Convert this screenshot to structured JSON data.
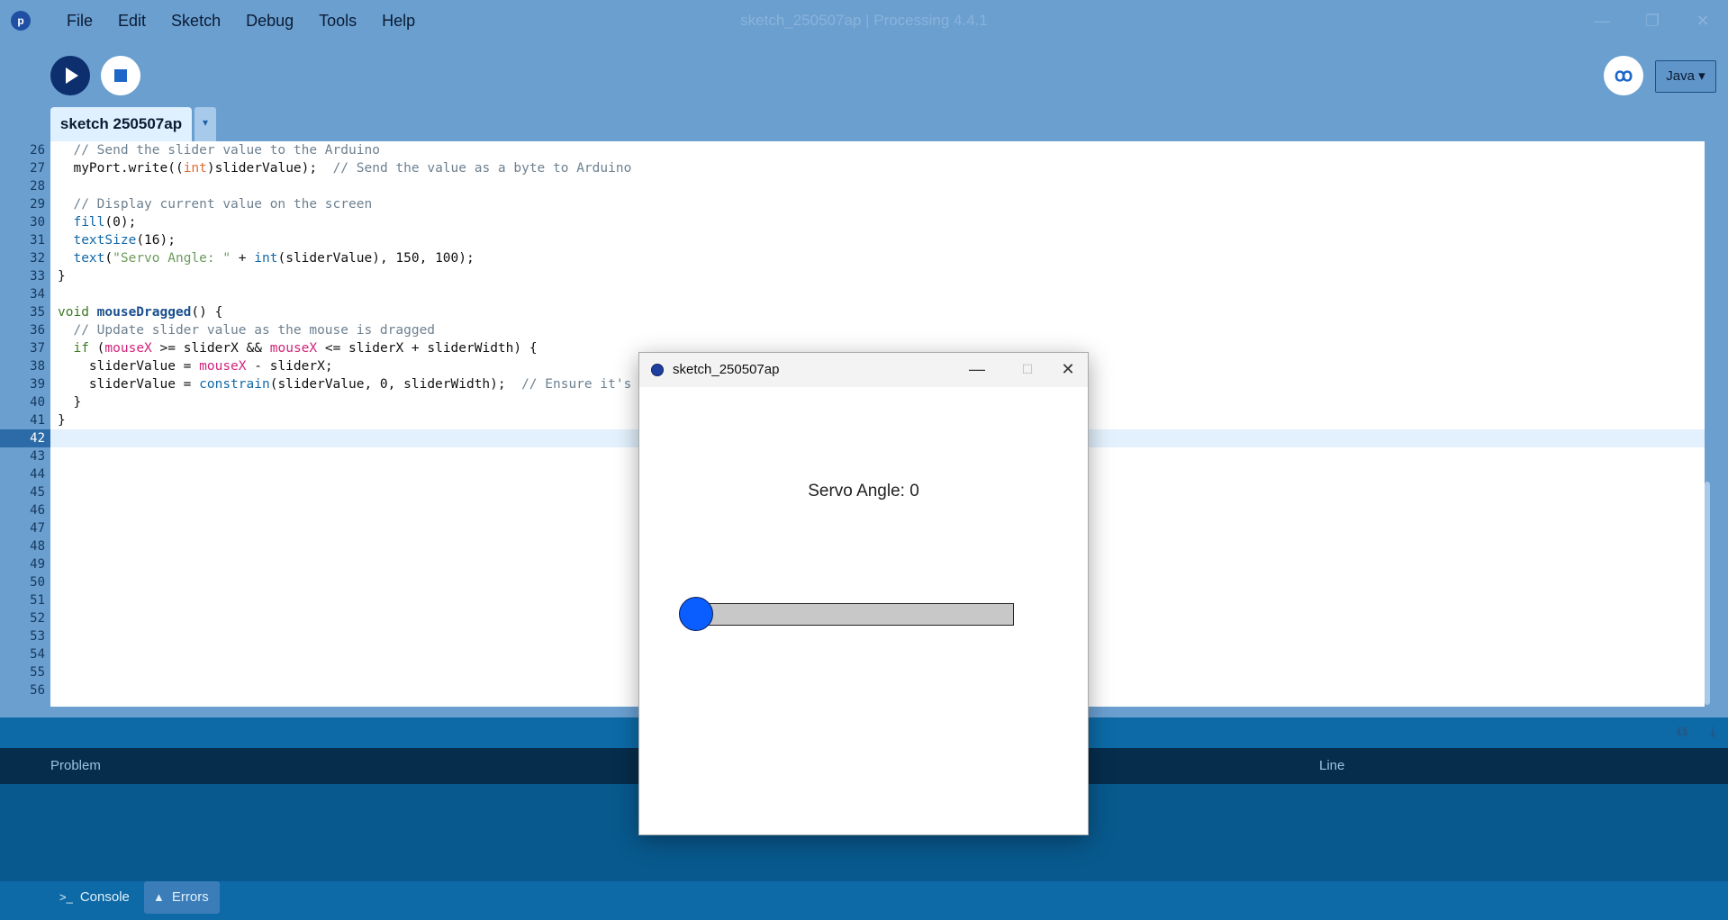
{
  "window": {
    "title": "sketch_250507ap | Processing 4.4.1",
    "app_icon": "processing-logo-icon"
  },
  "menu": [
    "File",
    "Edit",
    "Sketch",
    "Debug",
    "Tools",
    "Help"
  ],
  "toolbar": {
    "run_icon": "play-icon",
    "stop_icon": "stop-icon",
    "debug_icon": "debugger-icon",
    "mode": "Java ▾"
  },
  "tabs": {
    "active": "sketch 250507ap",
    "menu_glyph": "▾"
  },
  "editor": {
    "current_line": 42,
    "line_numbers": [
      "26",
      "27",
      "28",
      "29",
      "30",
      "31",
      "32",
      "33",
      "34",
      "35",
      "36",
      "37",
      "38",
      "39",
      "40",
      "41",
      "42",
      "43",
      "44",
      "45",
      "46",
      "47",
      "48",
      "49",
      "50",
      "51",
      "52",
      "53",
      "54",
      "55",
      "56"
    ],
    "code": [
      "  // Send the slider value to the Arduino",
      "  myPort.write((int)sliderValue);  // Send the value as a byte to Arduino",
      "",
      "  // Display current value on the screen",
      "  fill(0);",
      "  textSize(16);",
      "  text(\"Servo Angle: \" + int(sliderValue), 150, 100);",
      "}",
      "",
      "void mouseDragged() {",
      "  // Update slider value as the mouse is dragged",
      "  if (mouseX >= sliderX && mouseX <= sliderX + sliderWidth) {",
      "    sliderValue = mouseX - sliderX;",
      "    sliderValue = constrain(sliderValue, 0, sliderWidth);  // Ensure it's",
      "  }",
      "}"
    ]
  },
  "problems": {
    "col_problem": "Problem",
    "col_line": "Line"
  },
  "footer": {
    "console_label": "Console",
    "errors_label": "Errors"
  },
  "sketch_window": {
    "title": "sketch_250507ap",
    "servo_text": "Servo Angle: 0",
    "slider_value": 0
  },
  "colors": {
    "background": "#6a9fd0",
    "accent": "#0d2f6e",
    "slider_knob": "#0a5eff"
  }
}
